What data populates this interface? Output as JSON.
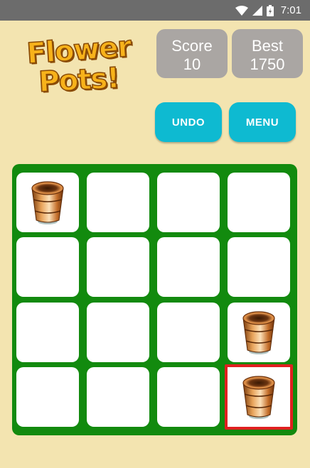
{
  "status_bar": {
    "time": "7:01",
    "icons": [
      "wifi-icon",
      "signal-icon",
      "battery-charging-icon"
    ]
  },
  "logo": {
    "line1": "Flower",
    "line2": "Pots!"
  },
  "score": {
    "label": "Score",
    "value": "10"
  },
  "best": {
    "label": "Best",
    "value": "1750"
  },
  "buttons": {
    "undo": "UNDO",
    "menu": "MENU"
  },
  "colors": {
    "background": "#f3e4b0",
    "board": "#128a0e",
    "button": "#0ebad1",
    "score_box": "#aaa6a3",
    "selected_border": "#e02020"
  },
  "board": {
    "rows": 4,
    "cols": 4,
    "cells": [
      [
        "flower-pot",
        "",
        "",
        ""
      ],
      [
        "",
        "",
        "",
        ""
      ],
      [
        "",
        "",
        "",
        "flower-pot"
      ],
      [
        "",
        "",
        "",
        "flower-pot"
      ]
    ],
    "selected": {
      "row": 4,
      "col": 4
    }
  }
}
